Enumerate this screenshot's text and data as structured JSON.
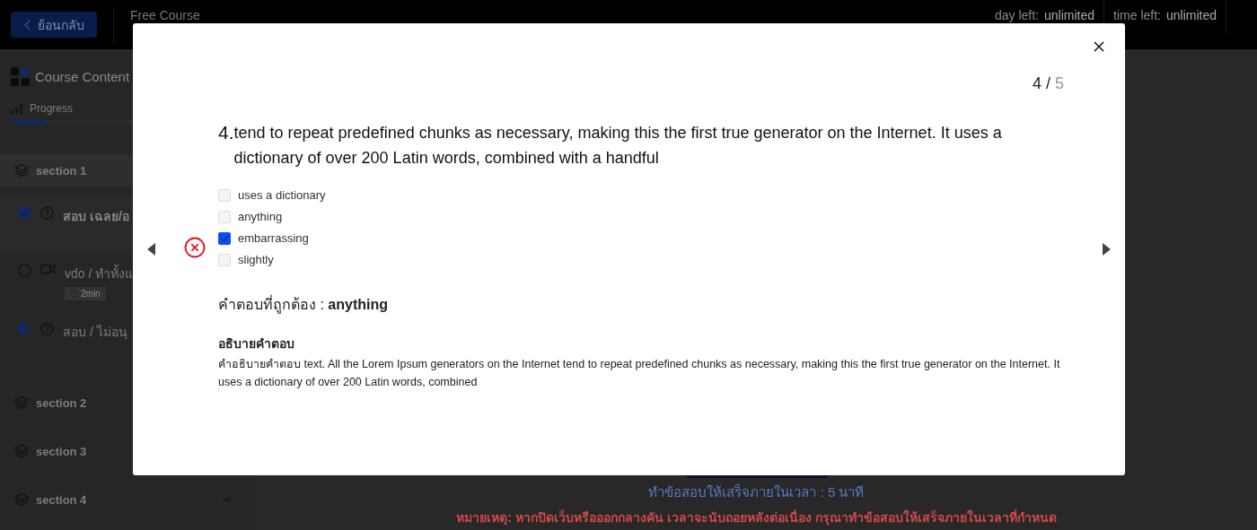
{
  "header": {
    "back_button": "ย้อนกลับ",
    "course_title": "Free Course",
    "day_left_label": "day left:",
    "day_left_value": "unlimited",
    "time_left_label": "time left:",
    "time_left_value": "unlimited"
  },
  "sidebar": {
    "title": "Course Content",
    "progress_label": "Progress",
    "progress": {
      "level": 0.15
    },
    "sections": [
      {
        "title": "section 1",
        "expanded": true,
        "lessons": [
          {
            "kind": "quiz",
            "completed": true,
            "in_progress": false,
            "title": "สอบ เฉลย/อ"
          },
          {
            "kind": "video",
            "completed": false,
            "in_progress": false,
            "title": "vdo / ทำทั้งแ",
            "duration": "2min"
          },
          {
            "kind": "quiz",
            "completed": false,
            "in_progress": true,
            "title": "สอบ / ไม่อนุ"
          }
        ]
      },
      {
        "title": "section 2",
        "expanded": false
      },
      {
        "title": "section 3",
        "expanded": false
      },
      {
        "title": "section 4",
        "expanded": false
      }
    ]
  },
  "main": {
    "time_limit": "ทำข้อสอบให้เสร็จภายในเวลา : 5 นาที",
    "note": "หมายเหตุ: หากปิดเว็บหรือออกกลางคัน เวลาจะนับถอยหลังต่อเนื่อง กรุณาทำข้อสอบให้เสร็จภายในเวลาที่กำหนด"
  },
  "quiz_modal": {
    "counter_current": "4",
    "counter_separator": "/",
    "counter_total": "5",
    "question_number": "4.",
    "question": "tend to repeat predefined chunks as necessary, making this the first true generator on the Internet. It uses a dictionary of over 200 Latin words, combined with a handful",
    "correct": false,
    "options": [
      {
        "label": "uses a dictionary",
        "checked": false
      },
      {
        "label": "anything",
        "checked": false
      },
      {
        "label": "embarrassing",
        "checked": true
      },
      {
        "label": "slightly",
        "checked": false
      }
    ],
    "answer": "คำตอบที่ถูกต้อง : **anything**",
    "explanation_title": "อธิบายคำตอบ",
    "explanation": "คำอธิบายคำตอบ text. All the Lorem Ipsum generators on the Internet tend to repeat predefined chunks as necessary, making this the first true generator on the Internet. It uses a dictionary of over 200 Latin words, combined"
  }
}
